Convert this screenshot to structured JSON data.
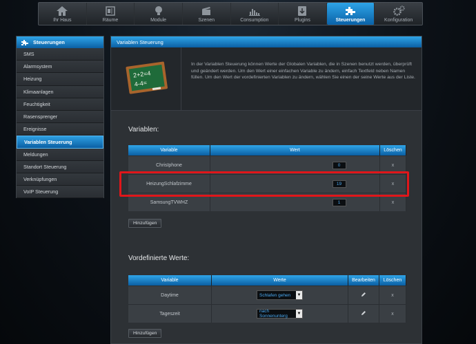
{
  "nav": {
    "tabs": [
      {
        "label": "Ihr Haus",
        "icon": "home-icon"
      },
      {
        "label": "Räume",
        "icon": "rooms-icon"
      },
      {
        "label": "Module",
        "icon": "bulb-icon"
      },
      {
        "label": "Szenen",
        "icon": "clapper-icon"
      },
      {
        "label": "Consumption",
        "icon": "chart-icon"
      },
      {
        "label": "Plugins",
        "icon": "download-icon"
      },
      {
        "label": "Steuerungen",
        "icon": "puzzle-icon",
        "active": true
      },
      {
        "label": "Konfiguration",
        "icon": "gears-icon"
      }
    ]
  },
  "sidebar": {
    "title": "Steuerungen",
    "items": [
      {
        "label": "SMS"
      },
      {
        "label": "Alarmsystem"
      },
      {
        "label": "Heizung"
      },
      {
        "label": "Klimaanlagen"
      },
      {
        "label": "Feuchtigkeit"
      },
      {
        "label": "Rasensprenger"
      },
      {
        "label": "Ereignisse"
      },
      {
        "label": "Variablen Steuerung",
        "active": true
      },
      {
        "label": "Meldungen"
      },
      {
        "label": "Standort Steuerung"
      },
      {
        "label": "Verknüpfungen"
      },
      {
        "label": "VoIP Steuerung"
      }
    ]
  },
  "main": {
    "title": "Variablen Steuerung",
    "intro": "In der Variablen Steuerung können Werte der Globalen Variablen, die in Szenen benutzt werden, überprüft und geändert werden. Um den Wert einer einfachen Variable zu ändern, einfach Textfeld neben Namen füllen. Um den Wert der vordefinierten Variablen zu ändern, wählen Sie einen der seine Werte aus der Liste.",
    "chalk_text": {
      "line1": "2+2=4",
      "line2": "4-4="
    },
    "variables": {
      "title": "Variablen:",
      "headers": {
        "variable": "Variable",
        "wert": "Wert",
        "loeschen": "Löschen"
      },
      "rows": [
        {
          "name": "ChrisIphone",
          "value": "0",
          "delete": "x"
        },
        {
          "name": "HeizungSchlafzimme",
          "value": "19",
          "delete": "x"
        },
        {
          "name": "SamsungTVWHZ",
          "value": "1",
          "delete": "x"
        }
      ],
      "add_label": "Hinzufügen"
    },
    "predefined": {
      "title": "Vordefinierte Werte:",
      "headers": {
        "variable": "Variable",
        "werte": "Werte",
        "bearbeiten": "Bearbeiten",
        "loeschen": "Löschen"
      },
      "rows": [
        {
          "name": "Daytime",
          "value": "Schlafen gehen",
          "delete": "x"
        },
        {
          "name": "Tageszeit",
          "value": "nach Sonnenunterg",
          "delete": "x"
        }
      ],
      "add_label": "Hinzufügen"
    }
  },
  "colors": {
    "accent": "#1e88d6",
    "highlight": "#e0161a"
  }
}
